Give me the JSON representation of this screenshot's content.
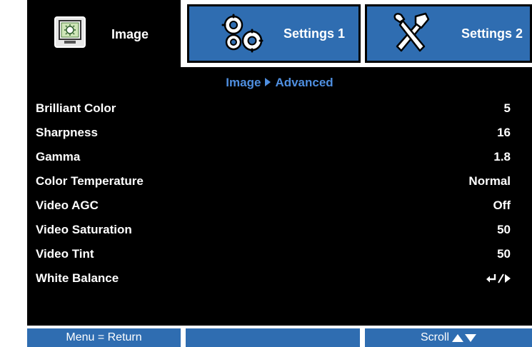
{
  "tabs": {
    "image": {
      "label": "Image",
      "icon": "image-settings-icon"
    },
    "settings1": {
      "label": "Settings 1",
      "icon": "gears-icon"
    },
    "settings2": {
      "label": "Settings 2",
      "icon": "tools-icon"
    }
  },
  "breadcrumb": {
    "parent": "Image",
    "current": "Advanced"
  },
  "menu": [
    {
      "label": "Brilliant Color",
      "value": "5"
    },
    {
      "label": "Sharpness",
      "value": "16"
    },
    {
      "label": "Gamma",
      "value": "1.8"
    },
    {
      "label": "Color Temperature",
      "value": "Normal"
    },
    {
      "label": "Video AGC",
      "value": "Off"
    },
    {
      "label": "Video Saturation",
      "value": "50"
    },
    {
      "label": "Video Tint",
      "value": "50"
    },
    {
      "label": "White Balance",
      "value": ""
    }
  ],
  "footer": {
    "left": "Menu = Return",
    "middle": "",
    "right": "Scroll"
  },
  "colors": {
    "accent_blue": "#2f6db1",
    "breadcrumb_blue": "#4f8fe0",
    "panel_bg": "#000000",
    "text": "#ffffff"
  }
}
